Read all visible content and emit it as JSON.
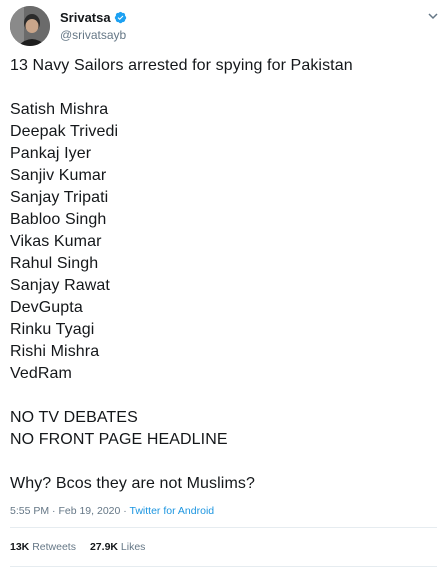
{
  "author": {
    "display_name": "Srivatsa",
    "handle": "@srivatsayb",
    "verified": true,
    "avatar_icon": "person-avatar-icon"
  },
  "tweet": {
    "headline": "13 Navy Sailors arrested for spying for Pakistan",
    "names": [
      "Satish Mishra",
      "Deepak Trivedi",
      "Pankaj Iyer",
      "Sanjiv Kumar",
      "Sanjay Tripati",
      "Babloo Singh",
      "Vikas Kumar",
      "Rahul Singh",
      "Sanjay Rawat",
      "DevGupta",
      "Rinku Tyagi",
      "Rishi Mishra",
      "VedRam"
    ],
    "statements": [
      "NO TV DEBATES",
      "NO FRONT PAGE HEADLINE"
    ],
    "closing": "Why? Bcos they are not Muslims?"
  },
  "meta": {
    "time": "5:55 PM",
    "separator": "·",
    "date": "Feb 19, 2020",
    "source": "Twitter for Android"
  },
  "stats": {
    "retweets_count": "13K",
    "retweets_label": "Retweets",
    "likes_count": "27.9K",
    "likes_label": "Likes"
  },
  "colors": {
    "text": "#14171a",
    "secondary": "#657786",
    "accent": "#1b95e0",
    "verified": "#1da1f2",
    "divider": "#e6ecf0"
  }
}
